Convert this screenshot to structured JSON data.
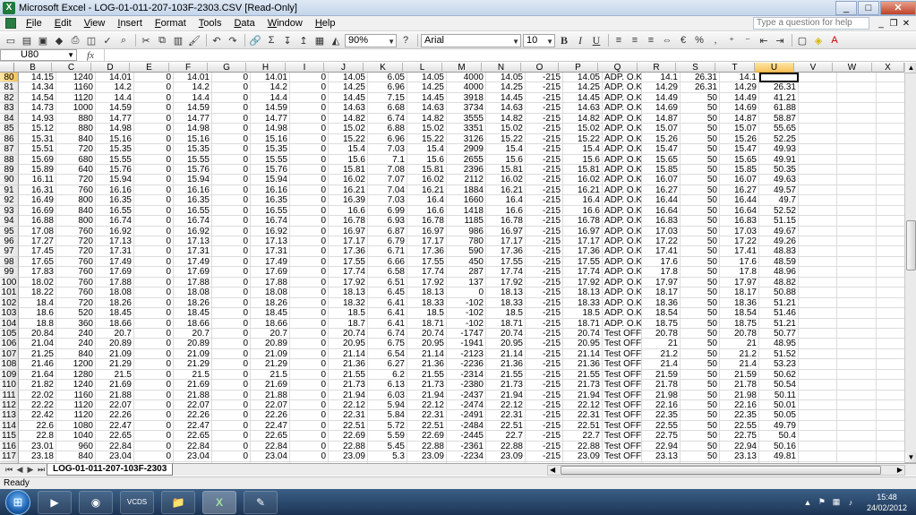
{
  "window": {
    "title": "Microsoft Excel - LOG-01-011-207-103F-2303.CSV  [Read-Only]",
    "min": "_",
    "max": "□",
    "close": "✕"
  },
  "menu": {
    "items": [
      "File",
      "Edit",
      "View",
      "Insert",
      "Format",
      "Tools",
      "Data",
      "Window",
      "Help"
    ],
    "help_placeholder": "Type a question for help",
    "mdi_min": "_",
    "mdi_restore": "❐",
    "mdi_close": "✕"
  },
  "toolbar": {
    "zoom": "90%",
    "font": "Arial",
    "size": "10",
    "bold": "B",
    "italic": "I",
    "underline": "U",
    "percent": "%",
    "currency": "€"
  },
  "formula": {
    "cell_ref": "U80",
    "fx": "fx",
    "content": ""
  },
  "columns": [
    "B",
    "C",
    "D",
    "E",
    "F",
    "G",
    "H",
    "I",
    "J",
    "K",
    "L",
    "M",
    "N",
    "O",
    "P",
    "Q",
    "R",
    "S",
    "T",
    "U",
    "V",
    "W",
    "X"
  ],
  "active_column": "U",
  "active_row": "80",
  "rows": [
    [
      "80",
      "14.15",
      "1240",
      "14.01",
      "0",
      "14.01",
      "0",
      "14.01",
      "0",
      "14.05",
      "6.05",
      "14.05",
      "4000",
      "14.05",
      "-215",
      "14.05",
      "ADP. O.K.",
      "14.1",
      "26.31",
      "14.1",
      "",
      "",
      "",
      ""
    ],
    [
      "81",
      "14.34",
      "1160",
      "14.2",
      "0",
      "14.2",
      "0",
      "14.2",
      "0",
      "14.25",
      "6.96",
      "14.25",
      "4000",
      "14.25",
      "-215",
      "14.25",
      "ADP. O.K.",
      "14.29",
      "26.31",
      "14.29",
      "26.31",
      "",
      "",
      ""
    ],
    [
      "82",
      "14.54",
      "1120",
      "14.4",
      "0",
      "14.4",
      "0",
      "14.4",
      "0",
      "14.45",
      "7.15",
      "14.45",
      "3918",
      "14.45",
      "-215",
      "14.45",
      "ADP. O.K.",
      "14.49",
      "50",
      "14.49",
      "41.21",
      "",
      "",
      ""
    ],
    [
      "83",
      "14.73",
      "1000",
      "14.59",
      "0",
      "14.59",
      "0",
      "14.59",
      "0",
      "14.63",
      "6.68",
      "14.63",
      "3734",
      "14.63",
      "-215",
      "14.63",
      "ADP. O.K.",
      "14.69",
      "50",
      "14.69",
      "61.88",
      "",
      "",
      ""
    ],
    [
      "84",
      "14.93",
      "880",
      "14.77",
      "0",
      "14.77",
      "0",
      "14.77",
      "0",
      "14.82",
      "6.74",
      "14.82",
      "3555",
      "14.82",
      "-215",
      "14.82",
      "ADP. O.K.",
      "14.87",
      "50",
      "14.87",
      "58.87",
      "",
      "",
      ""
    ],
    [
      "85",
      "15.12",
      "880",
      "14.98",
      "0",
      "14.98",
      "0",
      "14.98",
      "0",
      "15.02",
      "6.88",
      "15.02",
      "3351",
      "15.02",
      "-215",
      "15.02",
      "ADP. O.K.",
      "15.07",
      "50",
      "15.07",
      "55.65",
      "",
      "",
      ""
    ],
    [
      "86",
      "15.31",
      "840",
      "15.16",
      "0",
      "15.16",
      "0",
      "15.16",
      "0",
      "15.22",
      "6.96",
      "15.22",
      "3126",
      "15.22",
      "-215",
      "15.22",
      "ADP. O.K.",
      "15.26",
      "50",
      "15.26",
      "52.25",
      "",
      "",
      ""
    ],
    [
      "87",
      "15.51",
      "720",
      "15.35",
      "0",
      "15.35",
      "0",
      "15.35",
      "0",
      "15.4",
      "7.03",
      "15.4",
      "2909",
      "15.4",
      "-215",
      "15.4",
      "ADP. O.K.",
      "15.47",
      "50",
      "15.47",
      "49.93",
      "",
      "",
      ""
    ],
    [
      "88",
      "15.69",
      "680",
      "15.55",
      "0",
      "15.55",
      "0",
      "15.55",
      "0",
      "15.6",
      "7.1",
      "15.6",
      "2655",
      "15.6",
      "-215",
      "15.6",
      "ADP. O.K.",
      "15.65",
      "50",
      "15.65",
      "49.91",
      "",
      "",
      ""
    ],
    [
      "89",
      "15.89",
      "640",
      "15.76",
      "0",
      "15.76",
      "0",
      "15.76",
      "0",
      "15.81",
      "7.08",
      "15.81",
      "2396",
      "15.81",
      "-215",
      "15.81",
      "ADP. O.K.",
      "15.85",
      "50",
      "15.85",
      "50.35",
      "",
      "",
      ""
    ],
    [
      "90",
      "16.11",
      "720",
      "15.94",
      "0",
      "15.94",
      "0",
      "15.94",
      "0",
      "16.02",
      "7.07",
      "16.02",
      "2112",
      "16.02",
      "-215",
      "16.02",
      "ADP. O.K.",
      "16.07",
      "50",
      "16.07",
      "49.63",
      "",
      "",
      ""
    ],
    [
      "91",
      "16.31",
      "760",
      "16.16",
      "0",
      "16.16",
      "0",
      "16.16",
      "0",
      "16.21",
      "7.04",
      "16.21",
      "1884",
      "16.21",
      "-215",
      "16.21",
      "ADP. O.K.",
      "16.27",
      "50",
      "16.27",
      "49.57",
      "",
      "",
      ""
    ],
    [
      "92",
      "16.49",
      "800",
      "16.35",
      "0",
      "16.35",
      "0",
      "16.35",
      "0",
      "16.39",
      "7.03",
      "16.4",
      "1660",
      "16.4",
      "-215",
      "16.4",
      "ADP. O.K.",
      "16.44",
      "50",
      "16.44",
      "49.7",
      "",
      "",
      ""
    ],
    [
      "93",
      "16.69",
      "840",
      "16.55",
      "0",
      "16.55",
      "0",
      "16.55",
      "0",
      "16.6",
      "6.99",
      "16.6",
      "1418",
      "16.6",
      "-215",
      "16.6",
      "ADP. O.K.",
      "16.64",
      "50",
      "16.64",
      "52.52",
      "",
      "",
      ""
    ],
    [
      "94",
      "16.88",
      "800",
      "16.74",
      "0",
      "16.74",
      "0",
      "16.74",
      "0",
      "16.78",
      "6.93",
      "16.78",
      "1185",
      "16.78",
      "-215",
      "16.78",
      "ADP. O.K.",
      "16.83",
      "50",
      "16.83",
      "51.15",
      "",
      "",
      ""
    ],
    [
      "95",
      "17.08",
      "760",
      "16.92",
      "0",
      "16.92",
      "0",
      "16.92",
      "0",
      "16.97",
      "6.87",
      "16.97",
      "986",
      "16.97",
      "-215",
      "16.97",
      "ADP. O.K.",
      "17.03",
      "50",
      "17.03",
      "49.67",
      "",
      "",
      ""
    ],
    [
      "96",
      "17.27",
      "720",
      "17.13",
      "0",
      "17.13",
      "0",
      "17.13",
      "0",
      "17.17",
      "6.79",
      "17.17",
      "780",
      "17.17",
      "-215",
      "17.17",
      "ADP. O.K.",
      "17.22",
      "50",
      "17.22",
      "49.26",
      "",
      "",
      ""
    ],
    [
      "97",
      "17.45",
      "720",
      "17.31",
      "0",
      "17.31",
      "0",
      "17.31",
      "0",
      "17.36",
      "6.71",
      "17.36",
      "590",
      "17.36",
      "-215",
      "17.36",
      "ADP. O.K.",
      "17.41",
      "50",
      "17.41",
      "48.83",
      "",
      "",
      ""
    ],
    [
      "98",
      "17.65",
      "760",
      "17.49",
      "0",
      "17.49",
      "0",
      "17.49",
      "0",
      "17.55",
      "6.66",
      "17.55",
      "450",
      "17.55",
      "-215",
      "17.55",
      "ADP. O.K.",
      "17.6",
      "50",
      "17.6",
      "48.59",
      "",
      "",
      ""
    ],
    [
      "99",
      "17.83",
      "760",
      "17.69",
      "0",
      "17.69",
      "0",
      "17.69",
      "0",
      "17.74",
      "6.58",
      "17.74",
      "287",
      "17.74",
      "-215",
      "17.74",
      "ADP. O.K.",
      "17.8",
      "50",
      "17.8",
      "48.96",
      "",
      "",
      ""
    ],
    [
      "100",
      "18.02",
      "760",
      "17.88",
      "0",
      "17.88",
      "0",
      "17.88",
      "0",
      "17.92",
      "6.51",
      "17.92",
      "137",
      "17.92",
      "-215",
      "17.92",
      "ADP. O.K.",
      "17.97",
      "50",
      "17.97",
      "48.82",
      "",
      "",
      ""
    ],
    [
      "101",
      "18.22",
      "760",
      "18.08",
      "0",
      "18.08",
      "0",
      "18.08",
      "0",
      "18.13",
      "6.45",
      "18.13",
      "0",
      "18.13",
      "-215",
      "18.13",
      "ADP. O.K.",
      "18.17",
      "50",
      "18.17",
      "50.88",
      "",
      "",
      ""
    ],
    [
      "102",
      "18.4",
      "720",
      "18.26",
      "0",
      "18.26",
      "0",
      "18.26",
      "0",
      "18.32",
      "6.41",
      "18.33",
      "-102",
      "18.33",
      "-215",
      "18.33",
      "ADP. O.K.",
      "18.36",
      "50",
      "18.36",
      "51.21",
      "",
      "",
      ""
    ],
    [
      "103",
      "18.6",
      "520",
      "18.45",
      "0",
      "18.45",
      "0",
      "18.45",
      "0",
      "18.5",
      "6.41",
      "18.5",
      "-102",
      "18.5",
      "-215",
      "18.5",
      "ADP. O.K.",
      "18.54",
      "50",
      "18.54",
      "51.46",
      "",
      "",
      ""
    ],
    [
      "104",
      "18.8",
      "360",
      "18.66",
      "0",
      "18.66",
      "0",
      "18.66",
      "0",
      "18.7",
      "6.41",
      "18.71",
      "-102",
      "18.71",
      "-215",
      "18.71",
      "ADP. O.K.",
      "18.75",
      "50",
      "18.75",
      "51.21",
      "",
      "",
      ""
    ],
    [
      "105",
      "20.84",
      "240",
      "20.7",
      "0",
      "20.7",
      "0",
      "20.7",
      "0",
      "20.74",
      "6.74",
      "20.74",
      "-1747",
      "20.74",
      "-215",
      "20.74",
      "Test OFF",
      "20.78",
      "50",
      "20.78",
      "50.77",
      "",
      "",
      ""
    ],
    [
      "106",
      "21.04",
      "240",
      "20.89",
      "0",
      "20.89",
      "0",
      "20.89",
      "0",
      "20.95",
      "6.75",
      "20.95",
      "-1941",
      "20.95",
      "-215",
      "20.95",
      "Test OFF",
      "21",
      "50",
      "21",
      "48.95",
      "",
      "",
      ""
    ],
    [
      "107",
      "21.25",
      "840",
      "21.09",
      "0",
      "21.09",
      "0",
      "21.09",
      "0",
      "21.14",
      "6.54",
      "21.14",
      "-2123",
      "21.14",
      "-215",
      "21.14",
      "Test OFF",
      "21.2",
      "50",
      "21.2",
      "51.52",
      "",
      "",
      ""
    ],
    [
      "108",
      "21.46",
      "1200",
      "21.29",
      "0",
      "21.29",
      "0",
      "21.29",
      "0",
      "21.36",
      "6.27",
      "21.36",
      "-2236",
      "21.36",
      "-215",
      "21.36",
      "Test OFF",
      "21.4",
      "50",
      "21.4",
      "53.23",
      "",
      "",
      ""
    ],
    [
      "109",
      "21.64",
      "1280",
      "21.5",
      "0",
      "21.5",
      "0",
      "21.5",
      "0",
      "21.55",
      "6.2",
      "21.55",
      "-2314",
      "21.55",
      "-215",
      "21.55",
      "Test OFF",
      "21.59",
      "50",
      "21.59",
      "50.62",
      "",
      "",
      ""
    ],
    [
      "110",
      "21.82",
      "1240",
      "21.69",
      "0",
      "21.69",
      "0",
      "21.69",
      "0",
      "21.73",
      "6.13",
      "21.73",
      "-2380",
      "21.73",
      "-215",
      "21.73",
      "Test OFF",
      "21.78",
      "50",
      "21.78",
      "50.54",
      "",
      "",
      ""
    ],
    [
      "111",
      "22.02",
      "1160",
      "21.88",
      "0",
      "21.88",
      "0",
      "21.88",
      "0",
      "21.94",
      "6.03",
      "21.94",
      "-2437",
      "21.94",
      "-215",
      "21.94",
      "Test OFF",
      "21.98",
      "50",
      "21.98",
      "50.11",
      "",
      "",
      ""
    ],
    [
      "112",
      "22.22",
      "1120",
      "22.07",
      "0",
      "22.07",
      "0",
      "22.07",
      "0",
      "22.12",
      "5.94",
      "22.12",
      "-2474",
      "22.12",
      "-215",
      "22.12",
      "Test OFF",
      "22.16",
      "50",
      "22.16",
      "50.01",
      "",
      "",
      ""
    ],
    [
      "113",
      "22.42",
      "1120",
      "22.26",
      "0",
      "22.26",
      "0",
      "22.26",
      "0",
      "22.31",
      "5.84",
      "22.31",
      "-2491",
      "22.31",
      "-215",
      "22.31",
      "Test OFF",
      "22.35",
      "50",
      "22.35",
      "50.05",
      "",
      "",
      ""
    ],
    [
      "114",
      "22.6",
      "1080",
      "22.47",
      "0",
      "22.47",
      "0",
      "22.47",
      "0",
      "22.51",
      "5.72",
      "22.51",
      "-2484",
      "22.51",
      "-215",
      "22.51",
      "Test OFF",
      "22.55",
      "50",
      "22.55",
      "49.79",
      "",
      "",
      ""
    ],
    [
      "115",
      "22.8",
      "1040",
      "22.65",
      "0",
      "22.65",
      "0",
      "22.65",
      "0",
      "22.69",
      "5.59",
      "22.69",
      "-2445",
      "22.7",
      "-215",
      "22.7",
      "Test OFF",
      "22.75",
      "50",
      "22.75",
      "50.4",
      "",
      "",
      ""
    ],
    [
      "116",
      "23.01",
      "960",
      "22.84",
      "0",
      "22.84",
      "0",
      "22.84",
      "0",
      "22.88",
      "5.45",
      "22.88",
      "-2361",
      "22.88",
      "-215",
      "22.88",
      "Test OFF",
      "22.94",
      "50",
      "22.94",
      "50.16",
      "",
      "",
      ""
    ],
    [
      "117",
      "23.18",
      "840",
      "23.04",
      "0",
      "23.04",
      "0",
      "23.04",
      "0",
      "23.09",
      "5.3",
      "23.09",
      "-2234",
      "23.09",
      "-215",
      "23.09",
      "Test OFF",
      "23.13",
      "50",
      "23.13",
      "49.81",
      "",
      "",
      ""
    ],
    [
      "118",
      "23.37",
      "760",
      "23.22",
      "0",
      "23.22",
      "0",
      "23.22",
      "0",
      "23.28",
      "5.18",
      "23.28",
      "-2065",
      "23.29",
      "-215",
      "23.29",
      "Test OFF",
      "23.33",
      "50",
      "23.33",
      "49.52",
      "",
      "",
      ""
    ]
  ],
  "sheet_tab": "LOG-01-011-207-103F-2303",
  "status": "Ready",
  "clock": {
    "time": "15:48",
    "date": "24/02/2012"
  },
  "taskbar": {
    "items": [
      "media-player",
      "chrome",
      "vcds",
      "explorer",
      "excel",
      "paint"
    ],
    "labels": [
      "▶",
      "◉",
      "VCDS",
      "📁",
      "X",
      "✎"
    ]
  }
}
